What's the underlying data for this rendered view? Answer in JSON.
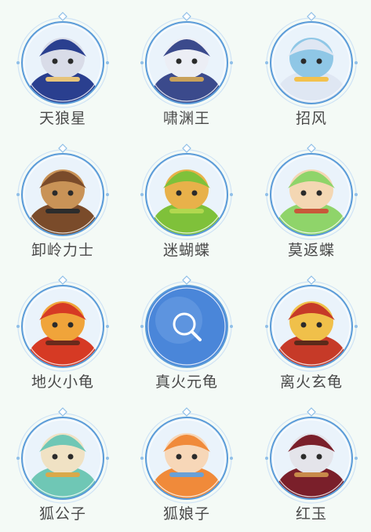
{
  "characters": [
    {
      "name": "天狼星",
      "icon": "white-wolf-warrior-portrait",
      "colors": [
        "#2a3f8f",
        "#d9dce8",
        "#e7c47a"
      ]
    },
    {
      "name": "啸渊王",
      "icon": "armored-wolf-king-portrait",
      "colors": [
        "#3b4a8c",
        "#eceef5",
        "#c9a15a"
      ]
    },
    {
      "name": "招风",
      "icon": "white-bird-portrait",
      "colors": [
        "#dfe7f3",
        "#8fc7e6",
        "#f2c14e"
      ]
    },
    {
      "name": "卸岭力士",
      "icon": "eagle-warrior-portrait",
      "colors": [
        "#7a4b2a",
        "#c99357",
        "#2c2c2c"
      ]
    },
    {
      "name": "迷蝴蝶",
      "icon": "green-bug-portrait",
      "colors": [
        "#7fc13a",
        "#e8b14a",
        "#b2d84f"
      ]
    },
    {
      "name": "莫返蝶",
      "icon": "green-hair-girl-portrait",
      "colors": [
        "#8fd46a",
        "#f4d7b3",
        "#c8583a"
      ]
    },
    {
      "name": "地火小龟",
      "icon": "red-fire-turtle-portrait",
      "colors": [
        "#d63a24",
        "#f0a43a",
        "#6a2a1c"
      ]
    },
    {
      "name": "真火元龟",
      "icon": "locked-search-icon",
      "locked": true,
      "colors": [
        "#4a86d9",
        "#ffffff"
      ]
    },
    {
      "name": "离火玄龟",
      "icon": "armored-fire-turtle-portrait",
      "colors": [
        "#c63a28",
        "#f0c04a",
        "#5b2a1a"
      ]
    },
    {
      "name": "狐公子",
      "icon": "teal-fox-portrait",
      "colors": [
        "#6fc7b5",
        "#f0e2c4",
        "#d9a94a"
      ]
    },
    {
      "name": "狐娘子",
      "icon": "orange-fox-girl-portrait",
      "colors": [
        "#f08a3a",
        "#f7d7b8",
        "#6aa0d6"
      ]
    },
    {
      "name": "红玉",
      "icon": "white-hair-archer-portrait",
      "colors": [
        "#7a1f2a",
        "#e4e4ea",
        "#c88a4a"
      ]
    }
  ],
  "frame_colors": {
    "ring": "#8fbfe8",
    "ring_dark": "#5a9bd8",
    "ring_light": "#cfe3f5"
  }
}
